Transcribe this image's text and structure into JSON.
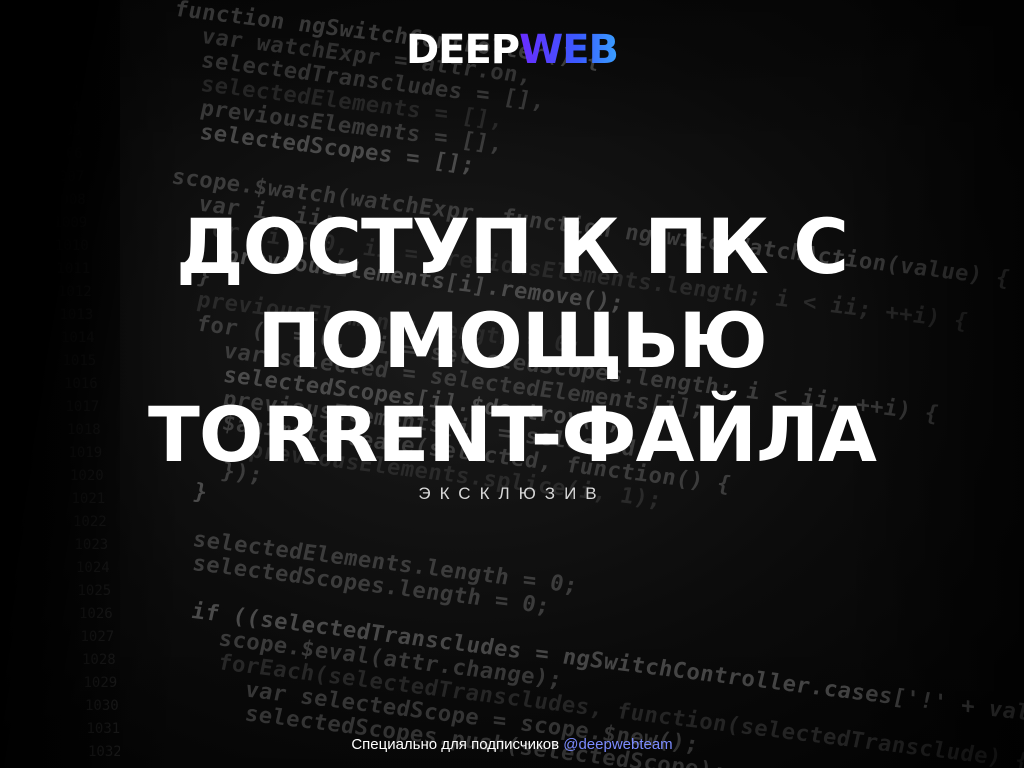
{
  "logo": {
    "part1": "DEEP",
    "part2": "WEB"
  },
  "title": {
    "line1": "ДОСТУП К  ПК С",
    "line2": "ПОМОЩЬЮ",
    "line3": "TORRENT-ФАЙЛА"
  },
  "subtitle": "ЭКСКЛЮЗИВ",
  "footer": {
    "text": "Специально для подписчиков",
    "handle": "@deepwebteam"
  },
  "colors": {
    "background": "#050505",
    "accent_start": "#6a2cff",
    "accent_end": "#3aa0ff",
    "handle": "#7c8cff"
  },
  "background_code": [
    "    function ngSwitchController() {",
    "      var watchExpr = attr.on,",
    "      selectedTranscludes = [],",
    "      selectedElements = [],",
    "      previousElements = [],",
    "      selectedScopes = [];",
    "",
    "    scope.$watch(watchExpr, function ngSwitchWatchAction(value) {",
    "      var i, ii;",
    "      for (i = 0, ii = previousElements.length; i < ii; ++i) {",
    "        previousElements[i].remove();",
    "      }",
    "      previousElements.length = 0;",
    "      for (i = 0, ii = selectedScopes.length; i < ii; ++i) {",
    "        var selected = selectedElements[i];",
    "        selectedScopes[i].$destroy();",
    "        previousElements[i] = selected;",
    "        $animate.leave(selected, function() {",
    "          previousElements.splice(i, 1);",
    "        });",
    "      }",
    "",
    "      selectedElements.length = 0;",
    "      selectedScopes.length = 0;",
    "",
    "      if ((selectedTranscludes = ngSwitchController.cases['!' + value] || ngSwitchC",
    "        scope.$eval(attr.change);",
    "        forEach(selectedTranscludes, function(selectedTransclude) {",
    "          var selectedScope = scope.$new();",
    "          selectedScopes.push(selectedScope);"
  ]
}
